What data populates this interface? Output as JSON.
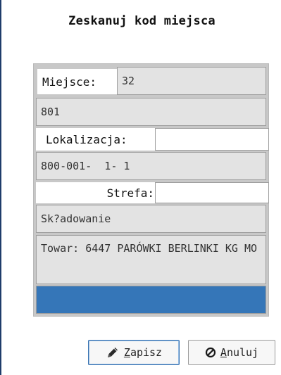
{
  "dialog": {
    "title": "Zeskanuj kod miejsca"
  },
  "form": {
    "miejsce_label": "Miejsce:",
    "miejsce_value": "32",
    "code_value": "801",
    "lokalizacja_label": "Lokalizacja:",
    "lokalizacja_input": "",
    "location_value": "800-001-  1- 1",
    "strefa_label": "Strefa:",
    "strefa_input": "",
    "zone_value": "Sk?adowanie",
    "product_value": "Towar: 6447 PARÓWKI BERLINKI KG MO",
    "status_bar_color": "#3576b8"
  },
  "buttons": {
    "save": {
      "icon": "pencil-icon",
      "accel": "Z",
      "rest": "apisz"
    },
    "cancel": {
      "icon": "cancel-circle-icon",
      "accel": "A",
      "rest": "nuluj"
    }
  }
}
